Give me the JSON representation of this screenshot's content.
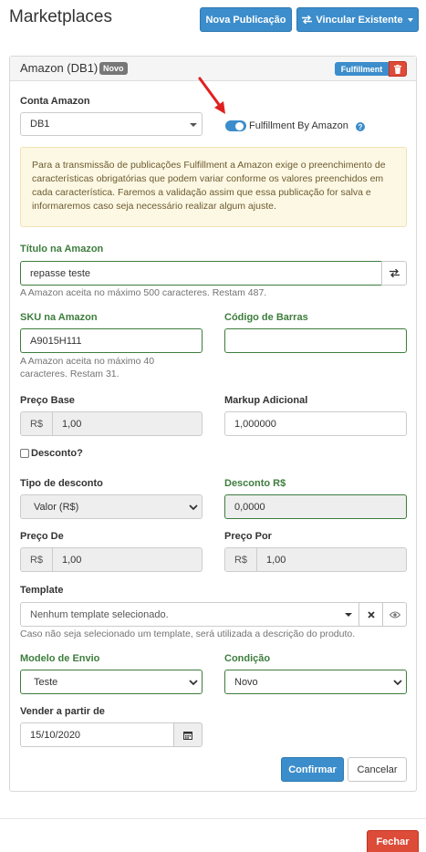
{
  "header": {
    "title": "Marketplaces",
    "new_publication_label": "Nova Publicação",
    "link_existing_label": "Vincular Existente"
  },
  "panel": {
    "title": "Amazon (DB1)",
    "badge_new": "Novo",
    "badge_fulfillment": "Fulfillment"
  },
  "account": {
    "label": "Conta Amazon",
    "value": "DB1",
    "fba_label": "Fulfillment By Amazon",
    "fba_enabled": true
  },
  "notice": {
    "text": "Para a transmissão de publicações Fulfillment a Amazon exige o preenchimento de características obrigatórias que podem variar conforme os valores preenchidos em cada característica. Faremos a validação assim que essa publicação for salva e informaremos caso seja necessário realizar algum ajuste."
  },
  "title_field": {
    "label": "Título na Amazon",
    "value": "repasse teste",
    "help": "A Amazon aceita no máximo 500 caracteres. Restam 487."
  },
  "sku": {
    "label": "SKU na Amazon",
    "value": "A9015H111",
    "help_line1": "A Amazon aceita no máximo 40",
    "help_line2": "caracteres. Restam 31."
  },
  "barcode": {
    "label": "Código de Barras",
    "value": ""
  },
  "base_price": {
    "label": "Preço Base",
    "currency": "R$",
    "value": "1,00"
  },
  "markup": {
    "label": "Markup Adicional",
    "value": "1,000000"
  },
  "discount": {
    "checkbox_label": "Desconto?",
    "checked": false,
    "type_label": "Tipo de desconto",
    "type_value": "Valor (R$)",
    "amount_label": "Desconto R$",
    "amount_value": "0,0000"
  },
  "price_from": {
    "label": "Preço De",
    "currency": "R$",
    "value": "1,00"
  },
  "price_to": {
    "label": "Preço Por",
    "currency": "R$",
    "value": "1,00"
  },
  "template": {
    "label": "Template",
    "value": "Nenhum template selecionado.",
    "help": "Caso não seja selecionado um template, será utilizada a descrição do produto."
  },
  "shipping": {
    "label": "Modelo de Envio",
    "value": "Teste"
  },
  "condition": {
    "label": "Condição",
    "value": "Novo"
  },
  "sell_from": {
    "label": "Vender a partir de",
    "value": "15/10/2020"
  },
  "actions": {
    "confirm_label": "Confirmar",
    "cancel_label": "Cancelar",
    "close_label": "Fechar"
  },
  "colors": {
    "primary": "#3c8dcb",
    "danger": "#dd4b39",
    "success_label": "#3d7d3d",
    "warning_bg": "#fcf8e3",
    "annotation_arrow": "#e02020"
  }
}
